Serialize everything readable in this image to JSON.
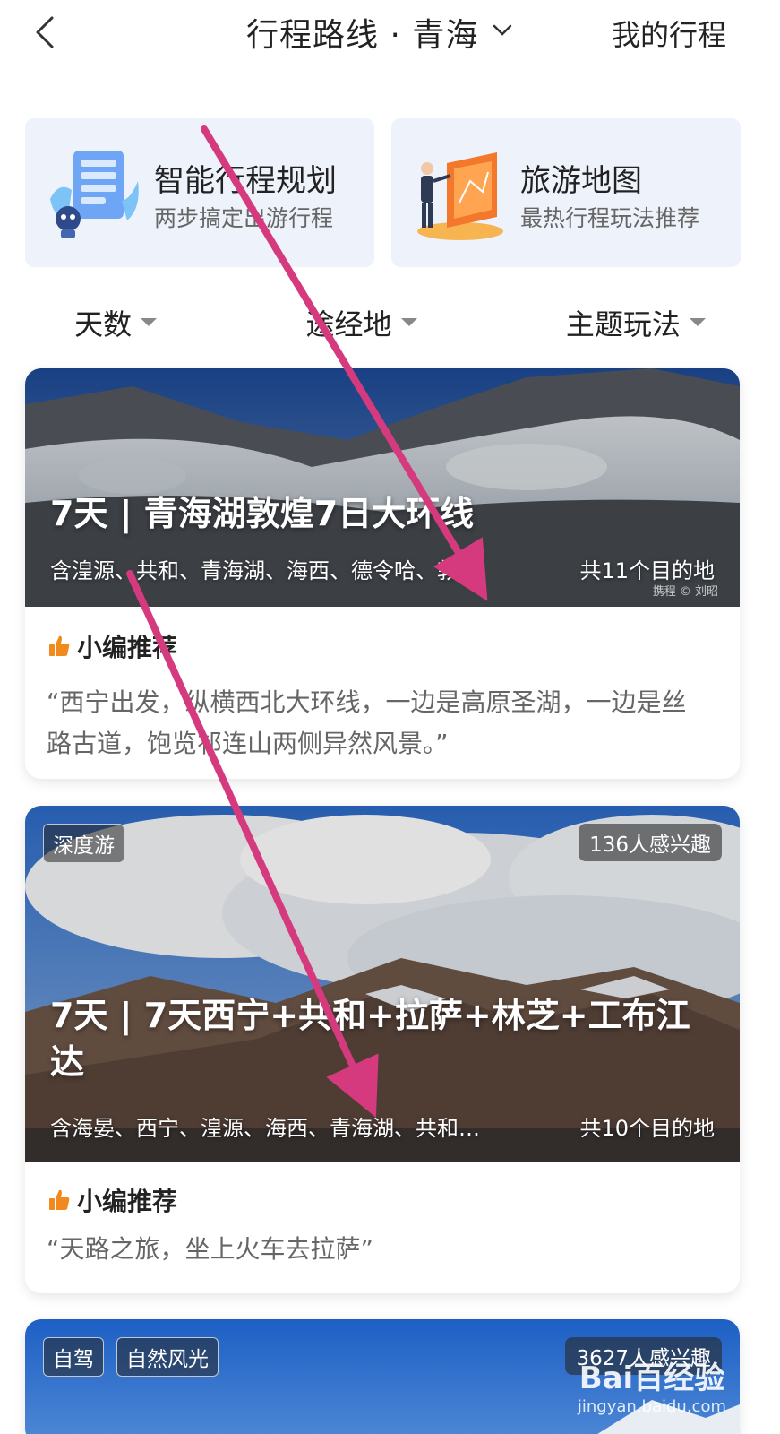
{
  "header": {
    "title": "行程路线 · 青海",
    "my_trip": "我的行程"
  },
  "features": [
    {
      "title": "智能行程规划",
      "subtitle": "两步搞定出游行程"
    },
    {
      "title": "旅游地图",
      "subtitle": "最热行程玩法推荐"
    }
  ],
  "filters": [
    {
      "label": "天数"
    },
    {
      "label": "途经地"
    },
    {
      "label": "主题玩法"
    }
  ],
  "cards": [
    {
      "title": "7天 | 青海湖敦煌7日大环线",
      "dest_prefix": "含湟源、共和、青海湖、海西、德令哈、敦…",
      "dest_count": "共11个目的地",
      "photo_credit": "携程 © 刘昭",
      "rec_label": "小编推荐",
      "quote": "“西宁出发，纵横西北大环线，一边是高原圣湖，一边是丝路古道，饱览祁连山两侧异然风景。”"
    },
    {
      "tag": "深度游",
      "badge": "136人感兴趣",
      "title": "7天 | 7天西宁+共和+拉萨+林芝+工布江达",
      "dest_prefix": "含海晏、西宁、湟源、海西、青海湖、共和…",
      "dest_count": "共10个目的地",
      "rec_label": "小编推荐",
      "quote": "“天路之旅，坐上火车去拉萨”"
    },
    {
      "tags": [
        "自驾",
        "自然风光"
      ],
      "badge": "3627人感兴趣"
    }
  ],
  "watermark": {
    "logo": "Bai百经验",
    "url": "jingyan.baidu.com"
  },
  "colors": {
    "annotation_arrow": "#d63a7e",
    "feature_bg": "#eef2fb",
    "thumb_icon": "#f08a1c"
  }
}
